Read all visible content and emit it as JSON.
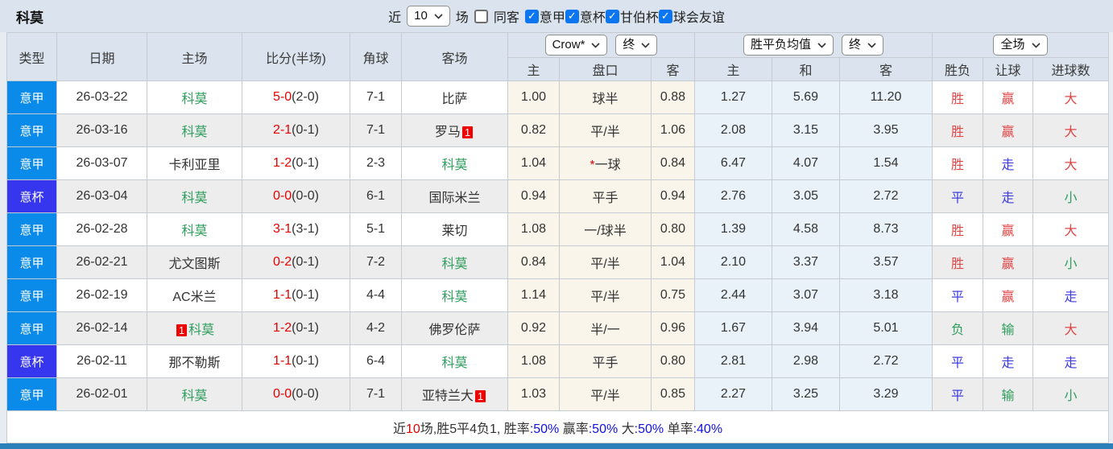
{
  "topbar": {
    "team": "科莫",
    "near_label": "近",
    "count": "10",
    "games_label": "场",
    "same_away_label": "同客",
    "same_away_checked": false,
    "leagues": [
      {
        "label": "意甲",
        "checked": true
      },
      {
        "label": "意杯",
        "checked": true
      },
      {
        "label": "甘伯杯",
        "checked": true
      },
      {
        "label": "球会友谊",
        "checked": true
      }
    ]
  },
  "icons": {
    "check": "✓"
  },
  "colors": {
    "serie_a_bg": "#0a8bea",
    "cup_bg": "#3636ee",
    "team_green": "#2f9e5e",
    "score_red": "#e80000",
    "result_red": "#e04545",
    "result_blue": "#3c3ce0",
    "result_green": "#2f9e5e",
    "stat_blue": "#1111dd",
    "stat_red": "#e00000"
  },
  "table": {
    "headers": [
      "类型",
      "日期",
      "主场",
      "比分(半场)",
      "角球",
      "客场"
    ],
    "crow_select": "Crow*",
    "period1": "终",
    "avg_select": "胜平负均值",
    "period2": "终",
    "scope_select": "全场",
    "sub_headers": [
      "主",
      "盘口",
      "客",
      "主",
      "和",
      "客",
      "胜负",
      "让球",
      "进球数"
    ]
  },
  "rows": [
    {
      "league": "意甲",
      "cup": false,
      "date": "26-03-22",
      "home": {
        "name": "科莫",
        "green": true
      },
      "ft": "5-0",
      "ht": "(2-0)",
      "corners": "7-1",
      "away": {
        "name": "比萨"
      },
      "o1": "1.00",
      "pan": "球半",
      "pan_star": false,
      "o2": "0.88",
      "a1": "1.27",
      "a2": "5.69",
      "a3": "11.20",
      "r": [
        [
          "胜",
          "red"
        ],
        [
          "赢",
          "red"
        ],
        [
          "大",
          "red"
        ]
      ]
    },
    {
      "league": "意甲",
      "cup": false,
      "date": "26-03-16",
      "home": {
        "name": "科莫",
        "green": true
      },
      "ft": "2-1",
      "ht": "(0-1)",
      "corners": "7-1",
      "away": {
        "name": "罗马",
        "badge": "1"
      },
      "o1": "0.82",
      "pan": "平/半",
      "pan_star": false,
      "o2": "1.06",
      "a1": "2.08",
      "a2": "3.15",
      "a3": "3.95",
      "r": [
        [
          "胜",
          "red"
        ],
        [
          "赢",
          "red"
        ],
        [
          "大",
          "red"
        ]
      ]
    },
    {
      "league": "意甲",
      "cup": false,
      "date": "26-03-07",
      "home": {
        "name": "卡利亚里"
      },
      "ft": "1-2",
      "ht": "(0-1)",
      "corners": "2-3",
      "away": {
        "name": "科莫",
        "green": true
      },
      "o1": "1.04",
      "pan": "一球",
      "pan_star": true,
      "o2": "0.84",
      "a1": "6.47",
      "a2": "4.07",
      "a3": "1.54",
      "r": [
        [
          "胜",
          "red"
        ],
        [
          "走",
          "blue"
        ],
        [
          "大",
          "red"
        ]
      ]
    },
    {
      "league": "意杯",
      "cup": true,
      "date": "26-03-04",
      "home": {
        "name": "科莫",
        "green": true
      },
      "ft": "0-0",
      "ht": "(0-0)",
      "corners": "6-1",
      "away": {
        "name": "国际米兰"
      },
      "o1": "0.94",
      "pan": "平手",
      "pan_star": false,
      "o2": "0.94",
      "a1": "2.76",
      "a2": "3.05",
      "a3": "2.72",
      "r": [
        [
          "平",
          "blue"
        ],
        [
          "走",
          "blue"
        ],
        [
          "小",
          "green"
        ]
      ]
    },
    {
      "league": "意甲",
      "cup": false,
      "date": "26-02-28",
      "home": {
        "name": "科莫",
        "green": true
      },
      "ft": "3-1",
      "ht": "(3-1)",
      "corners": "5-1",
      "away": {
        "name": "莱切"
      },
      "o1": "1.08",
      "pan": "一/球半",
      "pan_star": false,
      "o2": "0.80",
      "a1": "1.39",
      "a2": "4.58",
      "a3": "8.73",
      "r": [
        [
          "胜",
          "red"
        ],
        [
          "赢",
          "red"
        ],
        [
          "大",
          "red"
        ]
      ]
    },
    {
      "league": "意甲",
      "cup": false,
      "date": "26-02-21",
      "home": {
        "name": "尤文图斯"
      },
      "ft": "0-2",
      "ht": "(0-1)",
      "corners": "7-2",
      "away": {
        "name": "科莫",
        "green": true
      },
      "o1": "0.84",
      "pan": "平/半",
      "pan_star": false,
      "o2": "1.04",
      "a1": "2.10",
      "a2": "3.37",
      "a3": "3.57",
      "r": [
        [
          "胜",
          "red"
        ],
        [
          "赢",
          "red"
        ],
        [
          "小",
          "green"
        ]
      ]
    },
    {
      "league": "意甲",
      "cup": false,
      "date": "26-02-19",
      "home": {
        "name": "AC米兰"
      },
      "ft": "1-1",
      "ht": "(0-1)",
      "corners": "4-4",
      "away": {
        "name": "科莫",
        "green": true
      },
      "o1": "1.14",
      "pan": "平/半",
      "pan_star": false,
      "o2": "0.75",
      "a1": "2.44",
      "a2": "3.07",
      "a3": "3.18",
      "r": [
        [
          "平",
          "blue"
        ],
        [
          "赢",
          "red"
        ],
        [
          "走",
          "blue"
        ]
      ]
    },
    {
      "league": "意甲",
      "cup": false,
      "date": "26-02-14",
      "home": {
        "name": "科莫",
        "green": true,
        "badge": "1",
        "badge_before": true
      },
      "ft": "1-2",
      "ht": "(0-1)",
      "corners": "4-2",
      "away": {
        "name": "佛罗伦萨"
      },
      "o1": "0.92",
      "pan": "半/一",
      "pan_star": false,
      "o2": "0.96",
      "a1": "1.67",
      "a2": "3.94",
      "a3": "5.01",
      "r": [
        [
          "负",
          "green"
        ],
        [
          "输",
          "green"
        ],
        [
          "大",
          "red"
        ]
      ]
    },
    {
      "league": "意杯",
      "cup": true,
      "date": "26-02-11",
      "home": {
        "name": "那不勒斯"
      },
      "ft": "1-1",
      "ht": "(0-1)",
      "corners": "6-4",
      "away": {
        "name": "科莫",
        "green": true
      },
      "o1": "1.08",
      "pan": "平手",
      "pan_star": false,
      "o2": "0.80",
      "a1": "2.81",
      "a2": "2.98",
      "a3": "2.72",
      "r": [
        [
          "平",
          "blue"
        ],
        [
          "走",
          "blue"
        ],
        [
          "走",
          "blue"
        ]
      ]
    },
    {
      "league": "意甲",
      "cup": false,
      "date": "26-02-01",
      "home": {
        "name": "科莫",
        "green": true
      },
      "ft": "0-0",
      "ht": "(0-0)",
      "corners": "7-1",
      "away": {
        "name": "亚特兰大",
        "badge": "1"
      },
      "o1": "1.03",
      "pan": "平/半",
      "pan_star": false,
      "o2": "0.85",
      "a1": "2.27",
      "a2": "3.25",
      "a3": "3.29",
      "r": [
        [
          "平",
          "blue"
        ],
        [
          "输",
          "green"
        ],
        [
          "小",
          "green"
        ]
      ]
    }
  ],
  "footer": {
    "segments": [
      {
        "text": "近",
        "color": "#333333"
      },
      {
        "text": "10",
        "color": "#e00000"
      },
      {
        "text": "场,胜5平4负1, 胜率",
        "color": "#333333"
      },
      {
        "text": ":50%",
        "color": "#1111dd"
      },
      {
        "text": " 赢率",
        "color": "#333333"
      },
      {
        "text": ":50%",
        "color": "#1111dd"
      },
      {
        "text": " 大",
        "color": "#333333"
      },
      {
        "text": ":50%",
        "color": "#1111dd"
      },
      {
        "text": " 单率",
        "color": "#333333"
      },
      {
        "text": ":40%",
        "color": "#1111dd"
      }
    ]
  }
}
